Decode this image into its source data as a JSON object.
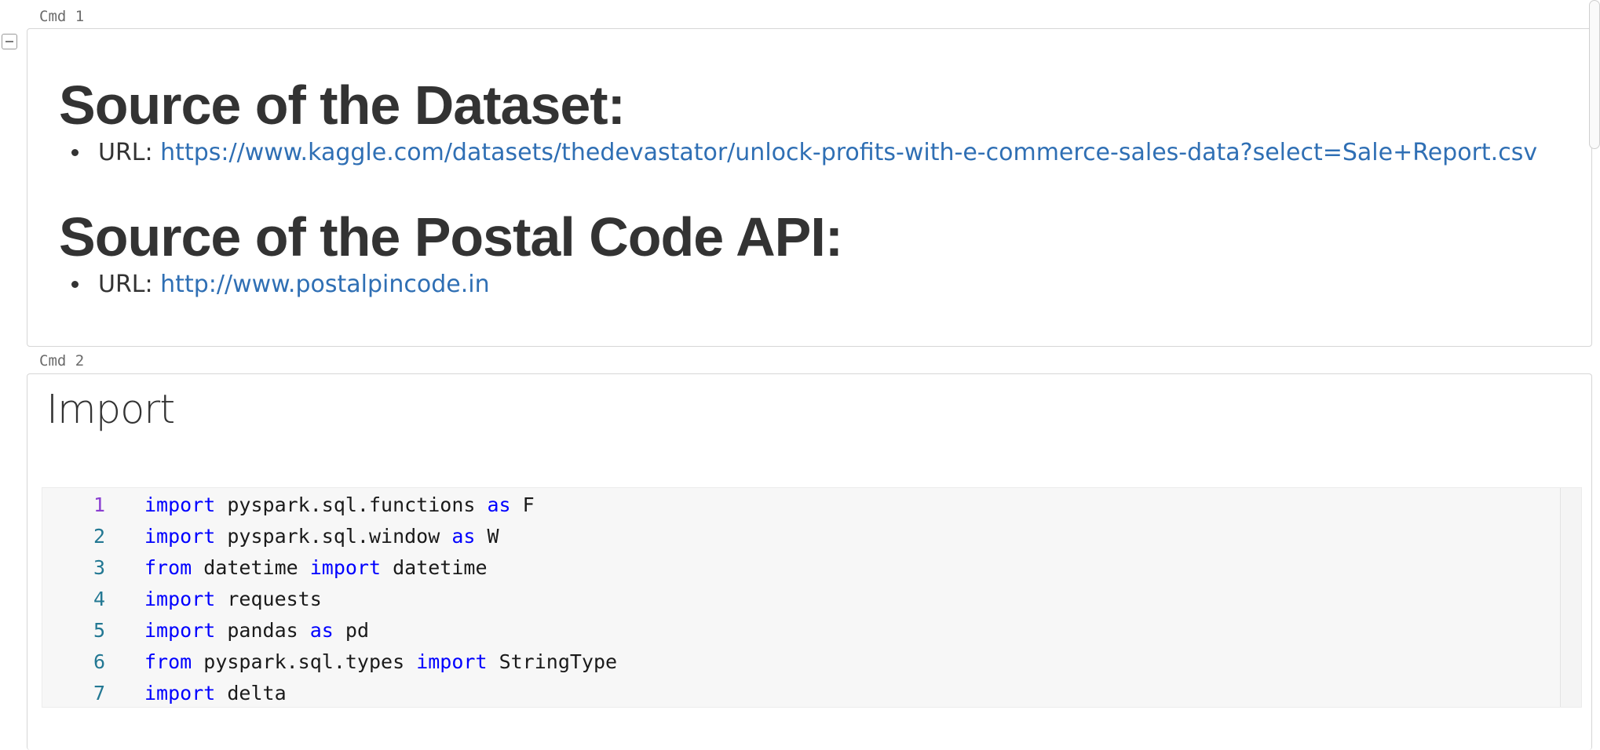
{
  "cells": [
    {
      "label": "Cmd 1",
      "sections": [
        {
          "heading": "Source of the Dataset:",
          "item_prefix": "URL: ",
          "link": "https://www.kaggle.com/datasets/thedevastator/unlock-profits-with-e-commerce-sales-data?select=Sale+Report.csv"
        },
        {
          "heading": "Source of the Postal Code API:",
          "item_prefix": "URL: ",
          "link": "http://www.postalpincode.in"
        }
      ]
    },
    {
      "label": "Cmd 2",
      "title": "Import",
      "code_lines": [
        {
          "num": "1",
          "tokens": [
            {
              "t": "import",
              "k": true
            },
            {
              "t": " pyspark.sql.functions ",
              "k": false
            },
            {
              "t": "as",
              "k": true
            },
            {
              "t": " F",
              "k": false
            }
          ]
        },
        {
          "num": "2",
          "tokens": [
            {
              "t": "import",
              "k": true
            },
            {
              "t": " pyspark.sql.window ",
              "k": false
            },
            {
              "t": "as",
              "k": true
            },
            {
              "t": " W",
              "k": false
            }
          ]
        },
        {
          "num": "3",
          "tokens": [
            {
              "t": "from",
              "k": true
            },
            {
              "t": " datetime ",
              "k": false
            },
            {
              "t": "import",
              "k": true
            },
            {
              "t": " datetime",
              "k": false
            }
          ]
        },
        {
          "num": "4",
          "tokens": [
            {
              "t": "import",
              "k": true
            },
            {
              "t": " requests",
              "k": false
            }
          ]
        },
        {
          "num": "5",
          "tokens": [
            {
              "t": "import",
              "k": true
            },
            {
              "t": " pandas ",
              "k": false
            },
            {
              "t": "as",
              "k": true
            },
            {
              "t": " pd",
              "k": false
            }
          ]
        },
        {
          "num": "6",
          "tokens": [
            {
              "t": "from",
              "k": true
            },
            {
              "t": " pyspark.sql.types ",
              "k": false
            },
            {
              "t": "import",
              "k": true
            },
            {
              "t": " StringType",
              "k": false
            }
          ]
        },
        {
          "num": "7",
          "tokens": [
            {
              "t": "import",
              "k": true
            },
            {
              "t": " delta",
              "k": false
            }
          ]
        }
      ]
    }
  ],
  "colors": {
    "keyword": "#0000ff",
    "link": "#2f6fb4",
    "line_number": "#237893",
    "active_line_number": "#8a3fd1"
  },
  "icons": {
    "collapse_toggle": "collapse-minus-icon"
  }
}
